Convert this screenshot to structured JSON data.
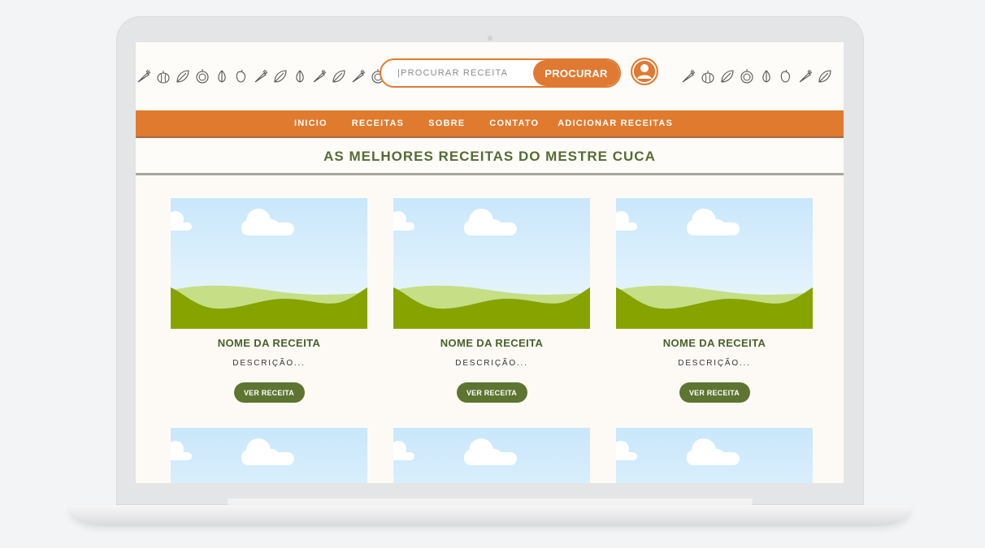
{
  "header": {
    "search_placeholder": "|PROCURAR RECEITA",
    "search_button": "PROCURAR",
    "avatar_icon": "user-icon"
  },
  "nav": {
    "items": [
      "INICIO",
      "RECEITAS",
      "SOBRE",
      "CONTATO",
      "ADICIONAR RECEITAS"
    ]
  },
  "page_title": "AS MELHORES RECEITAS DO MESTRE CUCA",
  "cards": [
    {
      "name": "NOME DA RECEITA",
      "description": "DESCRIÇÃO...",
      "button": "VER RECEITA"
    },
    {
      "name": "NOME DA RECEITA",
      "description": "DESCRIÇÃO...",
      "button": "VER RECEITA"
    },
    {
      "name": "NOME DA RECEITA",
      "description": "DESCRIÇÃO...",
      "button": "VER RECEITA"
    }
  ],
  "colors": {
    "accent": "#e07a2e",
    "green_dark": "#5e7431",
    "title_green": "#556b35",
    "sky": "#cde9fb",
    "hill_light": "#c6df86",
    "hill_dark": "#86a300"
  }
}
